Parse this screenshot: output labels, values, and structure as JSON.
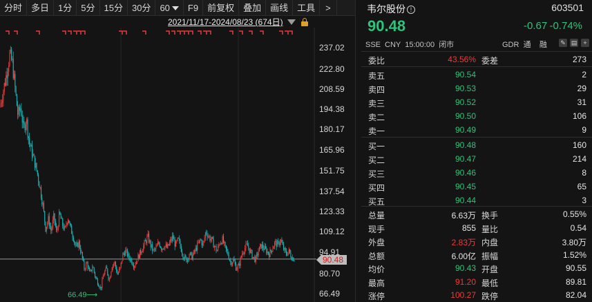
{
  "toolbar": {
    "items": [
      "分时",
      "多日",
      "1分",
      "5分",
      "15分",
      "30分",
      "60",
      "F9",
      "前复权",
      "叠加",
      "画线",
      "工具",
      ">"
    ]
  },
  "chart": {
    "range_text": "2021/11/17-2024/08/23 (674日)",
    "current_price_tag": "90.48",
    "min_label": "66.49⟶",
    "y_ticks": [
      "237.02",
      "222.80",
      "208.59",
      "194.38",
      "180.17",
      "165.96",
      "151.75",
      "137.54",
      "123.33",
      "109.12",
      "94.91",
      "80.70",
      "66.49"
    ]
  },
  "chart_data": {
    "type": "candlestick",
    "x_range": [
      "2021/11/17",
      "2024/08/23"
    ],
    "trading_days": 674,
    "ylim": [
      66.49,
      237.02
    ],
    "current_price": 90.48,
    "period_high": 237.02,
    "period_low": 66.49,
    "shape_points": [
      [
        0,
        196
      ],
      [
        8,
        215
      ],
      [
        14,
        232
      ],
      [
        18,
        226
      ],
      [
        22,
        208
      ],
      [
        26,
        190
      ],
      [
        30,
        196
      ],
      [
        34,
        180
      ],
      [
        38,
        188
      ],
      [
        42,
        172
      ],
      [
        46,
        165
      ],
      [
        50,
        158
      ],
      [
        54,
        150
      ],
      [
        58,
        140
      ],
      [
        62,
        128
      ],
      [
        66,
        112
      ],
      [
        70,
        118
      ],
      [
        74,
        110
      ],
      [
        78,
        120
      ],
      [
        82,
        108
      ],
      [
        86,
        122
      ],
      [
        90,
        115
      ],
      [
        94,
        110
      ],
      [
        98,
        120
      ],
      [
        102,
        112
      ],
      [
        106,
        106
      ],
      [
        110,
        98
      ],
      [
        114,
        102
      ],
      [
        118,
        94
      ],
      [
        122,
        84
      ],
      [
        126,
        88
      ],
      [
        130,
        80
      ],
      [
        134,
        86
      ],
      [
        138,
        78
      ],
      [
        142,
        74
      ],
      [
        146,
        70
      ],
      [
        150,
        80
      ],
      [
        154,
        84
      ],
      [
        158,
        76
      ],
      [
        162,
        86
      ],
      [
        166,
        88
      ],
      [
        170,
        80
      ],
      [
        174,
        84
      ],
      [
        178,
        94
      ],
      [
        182,
        96
      ],
      [
        186,
        92
      ],
      [
        190,
        90
      ],
      [
        194,
        86
      ],
      [
        198,
        90
      ],
      [
        202,
        94
      ],
      [
        206,
        98
      ],
      [
        210,
        102
      ],
      [
        214,
        106
      ],
      [
        218,
        100
      ],
      [
        222,
        96
      ],
      [
        226,
        98
      ],
      [
        230,
        102
      ],
      [
        234,
        98
      ],
      [
        238,
        100
      ],
      [
        242,
        98
      ],
      [
        246,
        102
      ],
      [
        250,
        106
      ],
      [
        254,
        100
      ],
      [
        258,
        104
      ],
      [
        262,
        98
      ],
      [
        266,
        92
      ],
      [
        270,
        90
      ],
      [
        274,
        94
      ],
      [
        278,
        92
      ],
      [
        282,
        96
      ],
      [
        286,
        100
      ],
      [
        290,
        104
      ],
      [
        294,
        100
      ],
      [
        298,
        110
      ],
      [
        302,
        106
      ],
      [
        306,
        104
      ],
      [
        310,
        100
      ],
      [
        314,
        96
      ],
      [
        318,
        102
      ],
      [
        322,
        104
      ],
      [
        326,
        98
      ],
      [
        330,
        94
      ],
      [
        334,
        88
      ],
      [
        338,
        90
      ],
      [
        342,
        84
      ],
      [
        346,
        86
      ],
      [
        350,
        94
      ],
      [
        354,
        98
      ],
      [
        358,
        100
      ],
      [
        362,
        96
      ],
      [
        366,
        92
      ],
      [
        370,
        90
      ],
      [
        374,
        96
      ],
      [
        378,
        100
      ],
      [
        382,
        98
      ],
      [
        386,
        96
      ],
      [
        390,
        94
      ],
      [
        394,
        98
      ],
      [
        398,
        102
      ],
      [
        402,
        100
      ],
      [
        406,
        104
      ],
      [
        410,
        98
      ],
      [
        414,
        94
      ],
      [
        418,
        96
      ],
      [
        422,
        92
      ],
      [
        426,
        90.48
      ]
    ]
  },
  "quote": {
    "name": "韦尔股份",
    "code": "603501",
    "price": "90.48",
    "change": "-0.67",
    "change_pct": "-0.74%",
    "meta": [
      "SSE",
      "CNY",
      "15:00:00",
      "闭市"
    ],
    "gdr": "GDR",
    "tong": "通",
    "rong": "融",
    "weibi": {
      "label": "委比",
      "value": "43.56%",
      "label2": "委差",
      "value2": "273"
    },
    "asks": [
      {
        "label": "卖五",
        "price": "90.54",
        "vol": "2"
      },
      {
        "label": "卖四",
        "price": "90.53",
        "vol": "29"
      },
      {
        "label": "卖三",
        "price": "90.52",
        "vol": "31"
      },
      {
        "label": "卖二",
        "price": "90.50",
        "vol": "106"
      },
      {
        "label": "卖一",
        "price": "90.49",
        "vol": "9"
      }
    ],
    "bids": [
      {
        "label": "买一",
        "price": "90.48",
        "vol": "160"
      },
      {
        "label": "买二",
        "price": "90.47",
        "vol": "214"
      },
      {
        "label": "买三",
        "price": "90.46",
        "vol": "8"
      },
      {
        "label": "买四",
        "price": "90.45",
        "vol": "65"
      },
      {
        "label": "买五",
        "price": "90.44",
        "vol": "3"
      }
    ],
    "stats": [
      {
        "l1": "总量",
        "v1": "6.63万",
        "c1": "white",
        "l2": "换手",
        "v2": "0.55%",
        "c2": "white"
      },
      {
        "l1": "现手",
        "v1": "855",
        "c1": "white",
        "l2": "量比",
        "v2": "0.54",
        "c2": "white"
      },
      {
        "l1": "外盘",
        "v1": "2.83万",
        "c1": "red",
        "l2": "内盘",
        "v2": "3.80万",
        "c2": "green"
      },
      {
        "l1": "总额",
        "v1": "6.00亿",
        "c1": "white",
        "l2": "振幅",
        "v2": "1.52%",
        "c2": "white"
      },
      {
        "l1": "均价",
        "v1": "90.43",
        "c1": "green",
        "l2": "开盘",
        "v2": "90.55",
        "c2": "green"
      },
      {
        "l1": "最高",
        "v1": "91.20",
        "c1": "red",
        "l2": "最低",
        "v2": "89.81",
        "c2": "green"
      },
      {
        "l1": "涨停",
        "v1": "100.27",
        "c1": "red",
        "l2": "跌停",
        "v2": "82.04",
        "c2": "green"
      }
    ]
  },
  "colors": {
    "up": "#ee3a3a",
    "down": "#2ec27a",
    "teal": "#17b6b6",
    "bg": "#141414"
  }
}
